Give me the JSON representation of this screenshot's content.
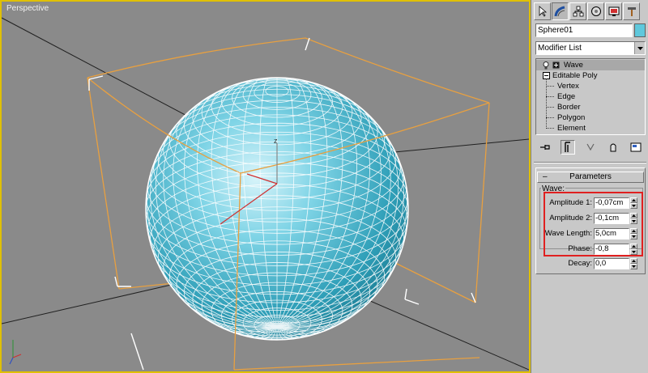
{
  "viewport": {
    "label": "Perspective"
  },
  "command_panel": {
    "tabs": [
      "create-tab",
      "modify-tab",
      "hierarchy-tab",
      "motion-tab",
      "display-tab",
      "utilities-tab"
    ],
    "object_name": "Sphere01",
    "object_color": "#5fc8dc",
    "modifier_list": "Modifier List",
    "stack": {
      "wave": "Wave",
      "editable_poly": "Editable Poly",
      "sub_objects": [
        "Vertex",
        "Edge",
        "Border",
        "Polygon",
        "Element"
      ]
    },
    "parameters": {
      "rollout_title": "Parameters",
      "group_label": "Wave:",
      "amplitude1_label": "Amplitude 1:",
      "amplitude1_value": "-0,07cm",
      "amplitude2_label": "Amplitude 2:",
      "amplitude2_value": "-0,1cm",
      "wavelength_label": "Wave Length:",
      "wavelength_value": "5,0cm",
      "phase_label": "Phase:",
      "phase_value": "-0,8",
      "decay_label": "Decay:",
      "decay_value": "0,0"
    }
  },
  "colors": {
    "viewport_bg": "#8a8a8a",
    "sphere": "#5fc8dc",
    "gizmo": "#e8a040",
    "highlight": "#e02020",
    "active_border": "#e0c000"
  }
}
